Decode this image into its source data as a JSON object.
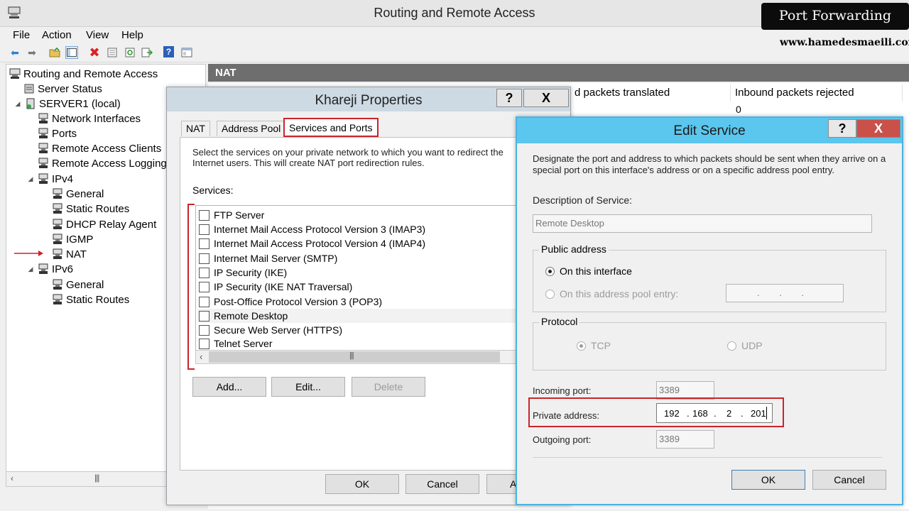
{
  "window": {
    "title": "Routing and Remote Access"
  },
  "menu": [
    "File",
    "Action",
    "View",
    "Help"
  ],
  "toolbar": [
    "back-icon",
    "forward-icon",
    "folder-up-icon",
    "show-hide-tree-icon",
    "delete-icon",
    "properties-icon",
    "refresh-icon",
    "export-icon",
    "help-icon",
    "console-icon"
  ],
  "tree": {
    "root": "Routing and Remote Access",
    "server_status": "Server Status",
    "server": "SERVER1 (local)",
    "network_interfaces": "Network Interfaces",
    "ports": "Ports",
    "remote_access_clients": "Remote Access Clients",
    "remote_access_logging": "Remote Access Logging",
    "ipv4": "IPv4",
    "ipv4_general": "General",
    "ipv4_static_routes": "Static Routes",
    "dhcp_relay": "DHCP Relay Agent",
    "igmp": "IGMP",
    "nat": "NAT",
    "ipv6": "IPv6",
    "ipv6_general": "General",
    "ipv6_static_routes": "Static Routes"
  },
  "nat_pane": {
    "header": "NAT",
    "col_inbound_translated": "d packets translated",
    "col_inbound_rejected": "Inbound packets rejected",
    "rejected_value": "0"
  },
  "properties_dialog": {
    "title": "Khareji Properties",
    "help_label": "?",
    "close_label": "X",
    "tabs": [
      "NAT",
      "Address Pool",
      "Services and Ports"
    ],
    "description": "Select the services on your private network to which you want to redirect the Internet users. This will create NAT port redirection rules.",
    "services_label": "Services:",
    "services": [
      "FTP Server",
      "Internet Mail Access Protocol Version 3 (IMAP3)",
      "Internet Mail Access Protocol Version 4 (IMAP4)",
      "Internet Mail Server (SMTP)",
      "IP Security (IKE)",
      "IP Security (IKE NAT Traversal)",
      "Post-Office Protocol Version 3 (POP3)",
      "Remote Desktop",
      "Secure Web Server (HTTPS)",
      "Telnet Server"
    ],
    "add_label": "Add...",
    "edit_label": "Edit...",
    "delete_label": "Delete",
    "ok_label": "OK",
    "cancel_label": "Cancel",
    "apply_label": "A"
  },
  "edit_dialog": {
    "title": "Edit Service",
    "help_label": "?",
    "close_label": "X",
    "description": "Designate the port and address to which packets should be sent when they arrive on a special port on this interface's address or on a specific address pool entry.",
    "description_label": "Description of Service:",
    "description_value": "Remote Desktop",
    "public_address_label": "Public address",
    "on_interface_label": "On this interface",
    "on_pool_label": "On this address pool entry:",
    "pool_ip_dots": ". . .",
    "protocol_label": "Protocol",
    "tcp_label": "TCP",
    "udp_label": "UDP",
    "incoming_port_label": "Incoming port:",
    "incoming_port_value": "3389",
    "private_address_label": "Private address:",
    "private_address": [
      "192",
      "168",
      "2",
      "201"
    ],
    "outgoing_port_label": "Outgoing port:",
    "outgoing_port_value": "3389",
    "ok_label": "OK",
    "cancel_label": "Cancel"
  },
  "watermark": {
    "title": "Port Forwarding",
    "url": "www.hamedesmaeili.com"
  }
}
